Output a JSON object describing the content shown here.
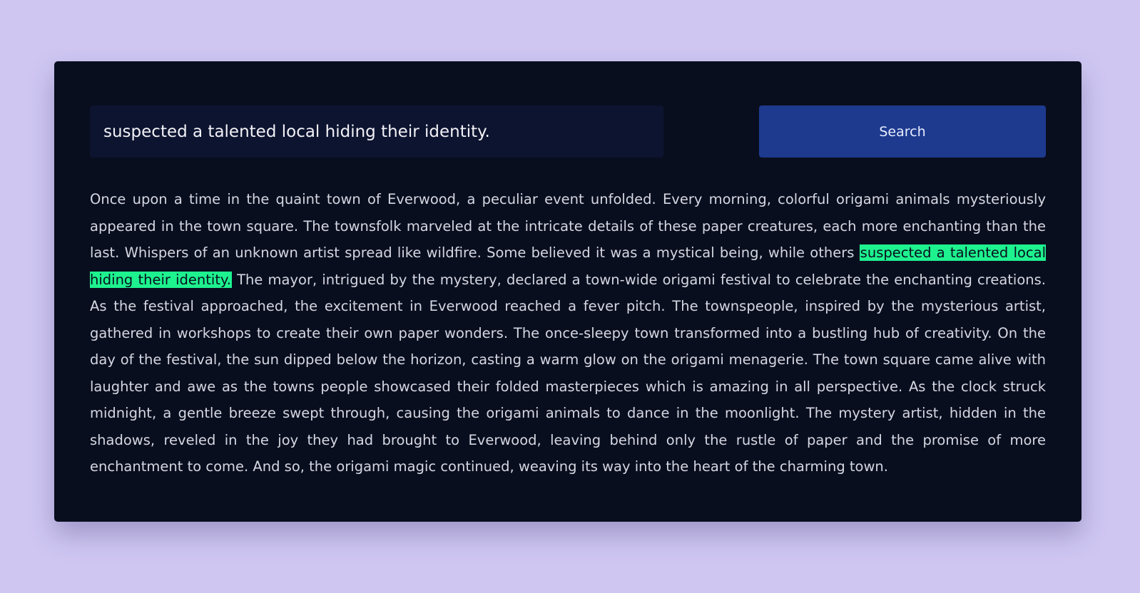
{
  "search": {
    "value": "suspected a talented local hiding their identity.",
    "button_label": "Search"
  },
  "story": {
    "before": "Once upon a time in the quaint town of Everwood, a peculiar event unfolded. Every morning, colorful origami animals mysteriously appeared in the town square. The townsfolk marveled at the intricate details of these paper creatures, each more enchanting than the last. Whispers of an unknown artist spread like wildfire. Some believed it was a mystical being, while others ",
    "highlight": "suspected a talented local hiding their identity.",
    "after": " The mayor, intrigued by the mystery, declared a town-wide origami festival to celebrate the enchanting creations. As the festival approached, the excitement in Everwood reached a fever pitch. The townspeople, inspired by the mysterious artist, gathered in workshops to create their own paper wonders. The once-sleepy town transformed into a bustling hub of creativity. On the day of the festival, the sun dipped below the horizon, casting a warm glow on the origami menagerie. The town square came alive with laughter and awe as the towns people showcased their folded masterpieces which is amazing in all perspective. As the clock struck midnight, a gentle breeze swept through, causing the origami animals to dance in the moonlight. The mystery artist, hidden in the shadows, reveled in the joy they had brought to Everwood, leaving behind only the rustle of paper and the promise of more enchantment to come. And so, the origami magic continued, weaving its way into the heart of the charming town."
  },
  "colors": {
    "background": "#cfc7f2",
    "card": "#090e1f",
    "input": "#0d1430",
    "button": "#1e3a8f",
    "highlight": "#1ef28f"
  }
}
